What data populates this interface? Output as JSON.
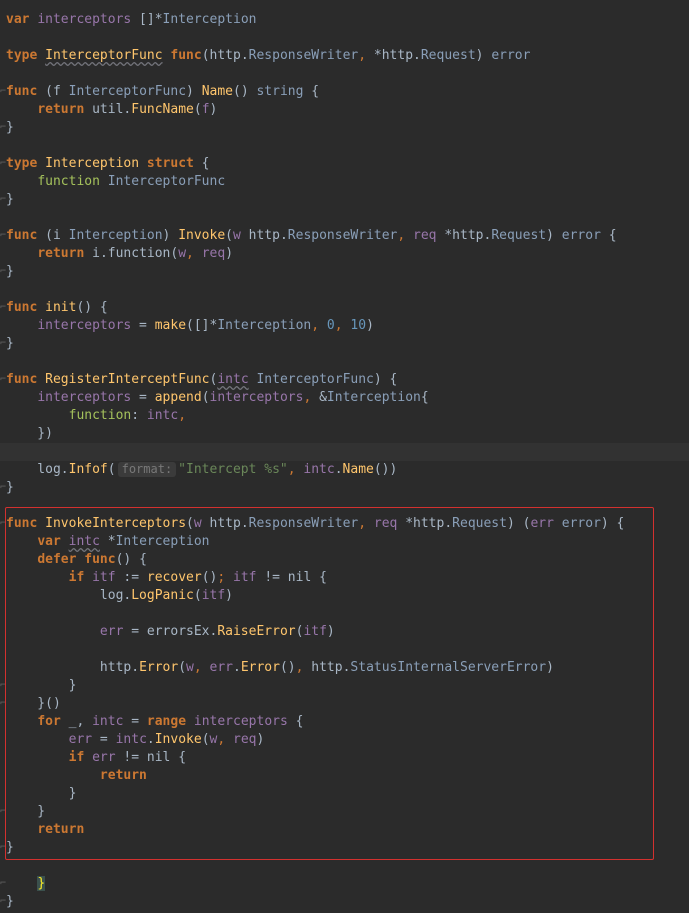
{
  "editor": {
    "language": "Go",
    "theme": "Darcula",
    "lines": [
      {
        "row": 1,
        "tokens": [
          [
            "k",
            "var"
          ],
          [
            "p",
            " "
          ],
          [
            "v",
            "interceptors"
          ],
          [
            "p",
            " []*"
          ],
          [
            "ty",
            "Interception"
          ]
        ]
      },
      {
        "row": 3,
        "tokens": [
          [
            "k",
            "type"
          ],
          [
            "p",
            " "
          ],
          [
            "fnw",
            "InterceptorFunc"
          ],
          [
            "p",
            " "
          ],
          [
            "k",
            "func"
          ],
          [
            "p",
            "(http."
          ],
          [
            "ty",
            "ResponseWriter"
          ],
          [
            "kn",
            ","
          ],
          [
            "p",
            " *http."
          ],
          [
            "ty",
            "Request"
          ],
          [
            "p",
            ") "
          ],
          [
            "ty",
            "error"
          ]
        ]
      },
      {
        "row": 5,
        "tokens": [
          [
            "k",
            "func"
          ],
          [
            "p",
            " ("
          ],
          [
            "par",
            "f"
          ],
          [
            "p",
            " "
          ],
          [
            "ty",
            "InterceptorFunc"
          ],
          [
            "p",
            ") "
          ],
          [
            "fn",
            "Name"
          ],
          [
            "p",
            "() "
          ],
          [
            "ty",
            "string"
          ],
          [
            "p",
            " {"
          ]
        ]
      },
      {
        "row": 6,
        "tokens": [
          [
            "p",
            "    "
          ],
          [
            "k",
            "return"
          ],
          [
            "p",
            " util."
          ],
          [
            "fn",
            "FuncName"
          ],
          [
            "p",
            "("
          ],
          [
            "v",
            "f"
          ],
          [
            "p",
            ")"
          ]
        ]
      },
      {
        "row": 7,
        "tokens": [
          [
            "p",
            "}"
          ]
        ]
      },
      {
        "row": 9,
        "tokens": [
          [
            "k",
            "type"
          ],
          [
            "p",
            " "
          ],
          [
            "fnu",
            "Interception"
          ],
          [
            "p",
            " "
          ],
          [
            "k",
            "struct"
          ],
          [
            "p",
            " {"
          ]
        ]
      },
      {
        "row": 10,
        "tokens": [
          [
            "p",
            "    "
          ],
          [
            "grn",
            "function"
          ],
          [
            "p",
            " "
          ],
          [
            "ty",
            "InterceptorFunc"
          ]
        ]
      },
      {
        "row": 11,
        "tokens": [
          [
            "p",
            "}"
          ]
        ]
      },
      {
        "row": 13,
        "tokens": [
          [
            "k",
            "func"
          ],
          [
            "p",
            " ("
          ],
          [
            "par",
            "i"
          ],
          [
            "p",
            " "
          ],
          [
            "ty",
            "Interception"
          ],
          [
            "p",
            ") "
          ],
          [
            "fn",
            "Invoke"
          ],
          [
            "p",
            "("
          ],
          [
            "v",
            "w"
          ],
          [
            "p",
            " http."
          ],
          [
            "ty",
            "ResponseWriter"
          ],
          [
            "kn",
            ","
          ],
          [
            "p",
            " "
          ],
          [
            "v",
            "req"
          ],
          [
            "p",
            " *http."
          ],
          [
            "ty",
            "Request"
          ],
          [
            "p",
            ") "
          ],
          [
            "ty",
            "error"
          ],
          [
            "p",
            " {"
          ]
        ]
      },
      {
        "row": 14,
        "tokens": [
          [
            "p",
            "    "
          ],
          [
            "k",
            "return"
          ],
          [
            "p",
            " "
          ],
          [
            "par",
            "i"
          ],
          [
            "p",
            "."
          ],
          [
            "grnb",
            "function"
          ],
          [
            "p",
            "("
          ],
          [
            "v",
            "w"
          ],
          [
            "kn",
            ","
          ],
          [
            "p",
            " "
          ],
          [
            "v",
            "req"
          ],
          [
            "p",
            ")"
          ]
        ]
      },
      {
        "row": 15,
        "tokens": [
          [
            "p",
            "}"
          ]
        ]
      },
      {
        "row": 17,
        "tokens": [
          [
            "k",
            "func"
          ],
          [
            "p",
            " "
          ],
          [
            "fn",
            "init"
          ],
          [
            "p",
            "() {"
          ]
        ]
      },
      {
        "row": 18,
        "tokens": [
          [
            "p",
            "    "
          ],
          [
            "v",
            "interceptors"
          ],
          [
            "p",
            " = "
          ],
          [
            "fn",
            "make"
          ],
          [
            "p",
            "([]*"
          ],
          [
            "ty",
            "Interception"
          ],
          [
            "kn",
            ","
          ],
          [
            "p",
            " "
          ],
          [
            "n",
            "0"
          ],
          [
            "kn",
            ","
          ],
          [
            "p",
            " "
          ],
          [
            "n",
            "10"
          ],
          [
            "p",
            ")"
          ]
        ]
      },
      {
        "row": 19,
        "tokens": [
          [
            "p",
            "}"
          ]
        ]
      },
      {
        "row": 21,
        "tokens": [
          [
            "k",
            "func"
          ],
          [
            "p",
            " "
          ],
          [
            "fn",
            "RegisterInterceptFunc"
          ],
          [
            "p",
            "("
          ],
          [
            "vw",
            "intc"
          ],
          [
            "p",
            " "
          ],
          [
            "ty",
            "InterceptorFunc"
          ],
          [
            "p",
            ") {"
          ]
        ]
      },
      {
        "row": 22,
        "tokens": [
          [
            "p",
            "    "
          ],
          [
            "v",
            "interceptors"
          ],
          [
            "p",
            " = "
          ],
          [
            "fn",
            "append"
          ],
          [
            "p",
            "("
          ],
          [
            "v",
            "interceptors"
          ],
          [
            "kn",
            ","
          ],
          [
            "p",
            " &"
          ],
          [
            "ty",
            "Interception"
          ],
          [
            "p",
            "{"
          ]
        ]
      },
      {
        "row": 23,
        "tokens": [
          [
            "p",
            "        "
          ],
          [
            "grn",
            "function"
          ],
          [
            "p",
            ": "
          ],
          [
            "v",
            "intc"
          ],
          [
            "kn",
            ","
          ]
        ]
      },
      {
        "row": 24,
        "tokens": [
          [
            "p",
            "    })"
          ]
        ]
      },
      {
        "row": 25,
        "hl": true,
        "tokens": []
      },
      {
        "row": 26,
        "tokens": [
          [
            "p",
            "    log."
          ],
          [
            "fn",
            "Infof"
          ],
          [
            "p",
            "("
          ],
          [
            "hint",
            "format:"
          ],
          [
            "s",
            "\"Intercept %s\""
          ],
          [
            "kn",
            ","
          ],
          [
            "p",
            " "
          ],
          [
            "v",
            "intc"
          ],
          [
            "p",
            "."
          ],
          [
            "fn",
            "Name"
          ],
          [
            "p",
            "())"
          ]
        ]
      },
      {
        "row": 27,
        "tokens": [
          [
            "p",
            "}"
          ]
        ]
      },
      {
        "row": 29,
        "tokens": [
          [
            "k",
            "func"
          ],
          [
            "p",
            " "
          ],
          [
            "fn",
            "InvokeInterceptors"
          ],
          [
            "p",
            "("
          ],
          [
            "v",
            "w"
          ],
          [
            "p",
            " http."
          ],
          [
            "ty",
            "ResponseWriter"
          ],
          [
            "kn",
            ","
          ],
          [
            "p",
            " "
          ],
          [
            "v",
            "req"
          ],
          [
            "p",
            " *http."
          ],
          [
            "ty",
            "Request"
          ],
          [
            "p",
            ") ("
          ],
          [
            "v",
            "err"
          ],
          [
            "p",
            " "
          ],
          [
            "ty",
            "error"
          ],
          [
            "p",
            ") {"
          ]
        ]
      },
      {
        "row": 30,
        "tokens": [
          [
            "p",
            "    "
          ],
          [
            "k",
            "var"
          ],
          [
            "p",
            " "
          ],
          [
            "vw",
            "intc"
          ],
          [
            "p",
            " *"
          ],
          [
            "ty",
            "Interception"
          ]
        ]
      },
      {
        "row": 31,
        "tokens": [
          [
            "p",
            "    "
          ],
          [
            "k",
            "defer"
          ],
          [
            "p",
            " "
          ],
          [
            "k",
            "func"
          ],
          [
            "p",
            "() {"
          ]
        ]
      },
      {
        "row": 32,
        "tokens": [
          [
            "p",
            "        "
          ],
          [
            "k",
            "if"
          ],
          [
            "p",
            " "
          ],
          [
            "v",
            "itf"
          ],
          [
            "p",
            " := "
          ],
          [
            "fn",
            "recover"
          ],
          [
            "p",
            "()"
          ],
          [
            "kn",
            ";"
          ],
          [
            "p",
            " "
          ],
          [
            "v",
            "itf"
          ],
          [
            "p",
            " != nil {"
          ]
        ]
      },
      {
        "row": 33,
        "tokens": [
          [
            "p",
            "            log."
          ],
          [
            "fn",
            "LogPanic"
          ],
          [
            "p",
            "("
          ],
          [
            "v",
            "itf"
          ],
          [
            "p",
            ")"
          ]
        ]
      },
      {
        "row": 35,
        "tokens": [
          [
            "p",
            "            "
          ],
          [
            "v",
            "err"
          ],
          [
            "p",
            " = errorsEx."
          ],
          [
            "fn",
            "RaiseError"
          ],
          [
            "p",
            "("
          ],
          [
            "v",
            "itf"
          ],
          [
            "p",
            ")"
          ]
        ]
      },
      {
        "row": 37,
        "tokens": [
          [
            "p",
            "            http."
          ],
          [
            "fn",
            "Error"
          ],
          [
            "p",
            "("
          ],
          [
            "v",
            "w"
          ],
          [
            "kn",
            ","
          ],
          [
            "p",
            " "
          ],
          [
            "v",
            "err"
          ],
          [
            "p",
            "."
          ],
          [
            "fn",
            "Error"
          ],
          [
            "p",
            "()"
          ],
          [
            "kn",
            ","
          ],
          [
            "p",
            " http."
          ],
          [
            "ty",
            "StatusInternalServerError"
          ],
          [
            "p",
            ")"
          ]
        ]
      },
      {
        "row": 38,
        "tokens": [
          [
            "p",
            "        }"
          ]
        ]
      },
      {
        "row": 39,
        "tokens": [
          [
            "p",
            "    }()"
          ]
        ]
      },
      {
        "row": 40,
        "tokens": [
          [
            "p",
            "    "
          ],
          [
            "k",
            "for"
          ],
          [
            "p",
            " _, "
          ],
          [
            "v",
            "intc"
          ],
          [
            "p",
            " = "
          ],
          [
            "k",
            "range"
          ],
          [
            "p",
            " "
          ],
          [
            "v",
            "interceptors"
          ],
          [
            "p",
            " {"
          ]
        ]
      },
      {
        "row": 41,
        "tokens": [
          [
            "p",
            "        "
          ],
          [
            "v",
            "err"
          ],
          [
            "p",
            " = "
          ],
          [
            "v",
            "intc"
          ],
          [
            "p",
            "."
          ],
          [
            "fn",
            "Invoke"
          ],
          [
            "p",
            "("
          ],
          [
            "v",
            "w"
          ],
          [
            "kn",
            ","
          ],
          [
            "p",
            " "
          ],
          [
            "v",
            "req"
          ],
          [
            "p",
            ")"
          ]
        ]
      },
      {
        "row": 42,
        "tokens": [
          [
            "p",
            "        "
          ],
          [
            "k",
            "if"
          ],
          [
            "p",
            " "
          ],
          [
            "v",
            "err"
          ],
          [
            "p",
            " != nil {"
          ]
        ]
      },
      {
        "row": 43,
        "tokens": [
          [
            "p",
            "            "
          ],
          [
            "k",
            "return"
          ]
        ]
      },
      {
        "row": 44,
        "tokens": [
          [
            "p",
            "        }"
          ]
        ]
      },
      {
        "row": 45,
        "tokens": [
          [
            "p",
            "    }"
          ]
        ]
      },
      {
        "row": 46,
        "tokens": [
          [
            "p",
            "    "
          ],
          [
            "k",
            "return"
          ]
        ]
      },
      {
        "row": 47,
        "tokens": [
          [
            "p",
            "}"
          ]
        ]
      },
      {
        "row": 49,
        "tokens": [
          [
            "p",
            "    "
          ],
          [
            "bm",
            "}"
          ]
        ]
      },
      {
        "row": 50,
        "tokens": [
          [
            "p",
            "}"
          ]
        ]
      }
    ],
    "fold_markers": [
      5,
      7,
      9,
      11,
      13,
      15,
      17,
      19,
      21,
      27,
      29,
      38,
      39,
      45,
      47,
      49,
      50
    ]
  },
  "selection_box": {
    "color": "#d3312f"
  }
}
